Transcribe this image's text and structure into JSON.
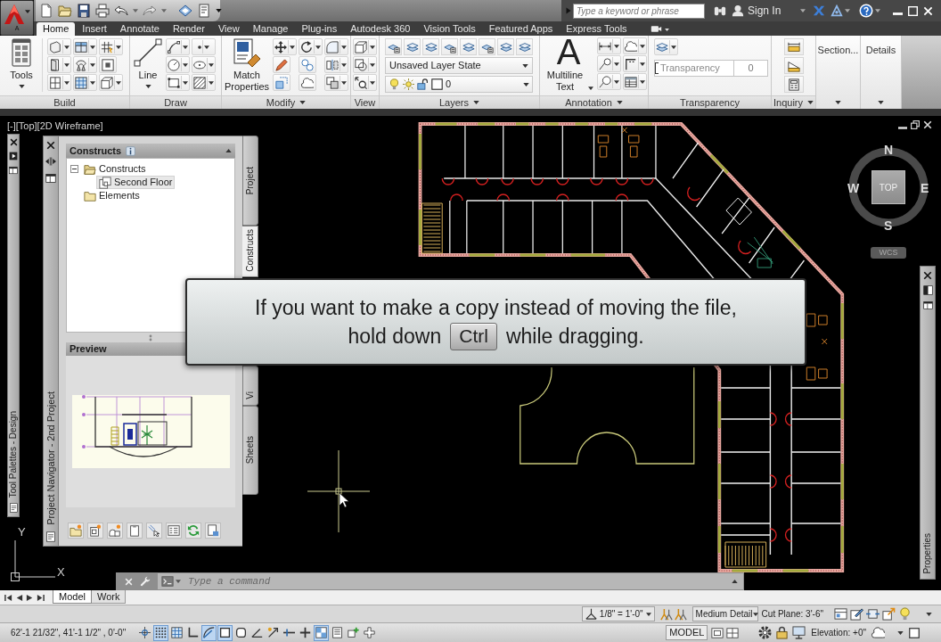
{
  "application_menu": {
    "label": "A"
  },
  "title_bar": {
    "search": {
      "placeholder": "Type a keyword or phrase"
    },
    "sign_in": "Sign In"
  },
  "ribbon_tabs": [
    {
      "label": "Home",
      "selected": true
    },
    {
      "label": "Insert",
      "selected": false
    },
    {
      "label": "Annotate",
      "selected": false
    },
    {
      "label": "Render",
      "selected": false
    },
    {
      "label": "View",
      "selected": false
    },
    {
      "label": "Manage",
      "selected": false
    },
    {
      "label": "Plug-ins",
      "selected": false
    },
    {
      "label": "Autodesk 360",
      "selected": false
    },
    {
      "label": "Vision Tools",
      "selected": false
    },
    {
      "label": "Featured Apps",
      "selected": false
    },
    {
      "label": "Express Tools",
      "selected": false
    }
  ],
  "ribbon_panels": [
    {
      "kind": "build",
      "title": "Build",
      "has_menu": false,
      "button": "Tools"
    },
    {
      "kind": "draw",
      "title": "Draw",
      "has_menu": false,
      "button": "Line"
    },
    {
      "kind": "modify",
      "title": "Modify",
      "has_menu": true,
      "button": "Match Properties"
    },
    {
      "kind": "view",
      "title": "View",
      "has_menu": false
    },
    {
      "kind": "layers",
      "title": "Layers",
      "has_menu": true,
      "layer_state": "Unsaved Layer State",
      "current_layer": "0"
    },
    {
      "kind": "annotation",
      "title": "Annotation",
      "has_menu": true,
      "button_glyph": "A",
      "button": "Multiline Text"
    },
    {
      "kind": "transparency",
      "title": "Transparency",
      "has_menu": false,
      "slider_label": "Transparency",
      "level": 0,
      "value": "0"
    },
    {
      "kind": "inquiry",
      "title": "Inquiry",
      "has_menu": true
    },
    {
      "kind": "slideout",
      "button": "Section..."
    },
    {
      "kind": "slideout",
      "button": "Details"
    }
  ],
  "viewport": {
    "label": "[-][Top][2D Wireframe]"
  },
  "tool_palette": {
    "title": "Tool Palettes - Design"
  },
  "project_navigator": {
    "title": "Project Navigator - 2nd Project",
    "section_title": "Constructs",
    "tree": [
      {
        "label": "Constructs",
        "expanded": true,
        "selected": false,
        "children": [
          {
            "label": "Second Floor",
            "selected": true
          }
        ]
      },
      {
        "label": "Elements",
        "selected": false
      }
    ],
    "preview_title": "Preview",
    "tabs": [
      {
        "label": "Project",
        "selected": false
      },
      {
        "label": "Constructs",
        "selected": true
      },
      {
        "label": "Vi",
        "selected": false
      },
      {
        "label": "Sheets",
        "selected": false
      }
    ]
  },
  "tooltip": {
    "line_1": "If you want to make a copy instead of moving the file,",
    "before_key": "hold down",
    "key": "Ctrl",
    "after_key": "while dragging."
  },
  "view_cube": {
    "north": "N",
    "west": "W",
    "east": "E",
    "south": "S",
    "face": "TOP",
    "coordinate_system": "WCS"
  },
  "ucs_icon": {
    "y_axis": "Y",
    "x_axis": "X"
  },
  "properties_palette": {
    "title": "Properties"
  },
  "command_line": {
    "placeholder": "Type a command"
  },
  "layout_tabs": [
    {
      "label": "Model",
      "selected": true
    },
    {
      "label": "Work",
      "selected": false
    }
  ],
  "drawing_status_bar": {
    "scale": "1/8\" = 1'-0\"",
    "detail_level": "Medium Detail",
    "cut_plane": "Cut Plane: 3'-6\""
  },
  "status_bar": {
    "coordinates": "62'-1 21/32\", 41'-1 1/2\" , 0'-0\"",
    "toggles": [
      {
        "on": false
      },
      {
        "on": true
      },
      {
        "on": false
      },
      {
        "on": false
      },
      {
        "on": true
      },
      {
        "on": true
      },
      {
        "on": false
      },
      {
        "on": false
      },
      {
        "on": false
      },
      {
        "on": false
      },
      {
        "on": false
      },
      {
        "on": true
      },
      {
        "on": false
      },
      {
        "on": false
      },
      {
        "on": false
      }
    ],
    "space": "MODEL",
    "elevation": "Elevation: +0\""
  }
}
